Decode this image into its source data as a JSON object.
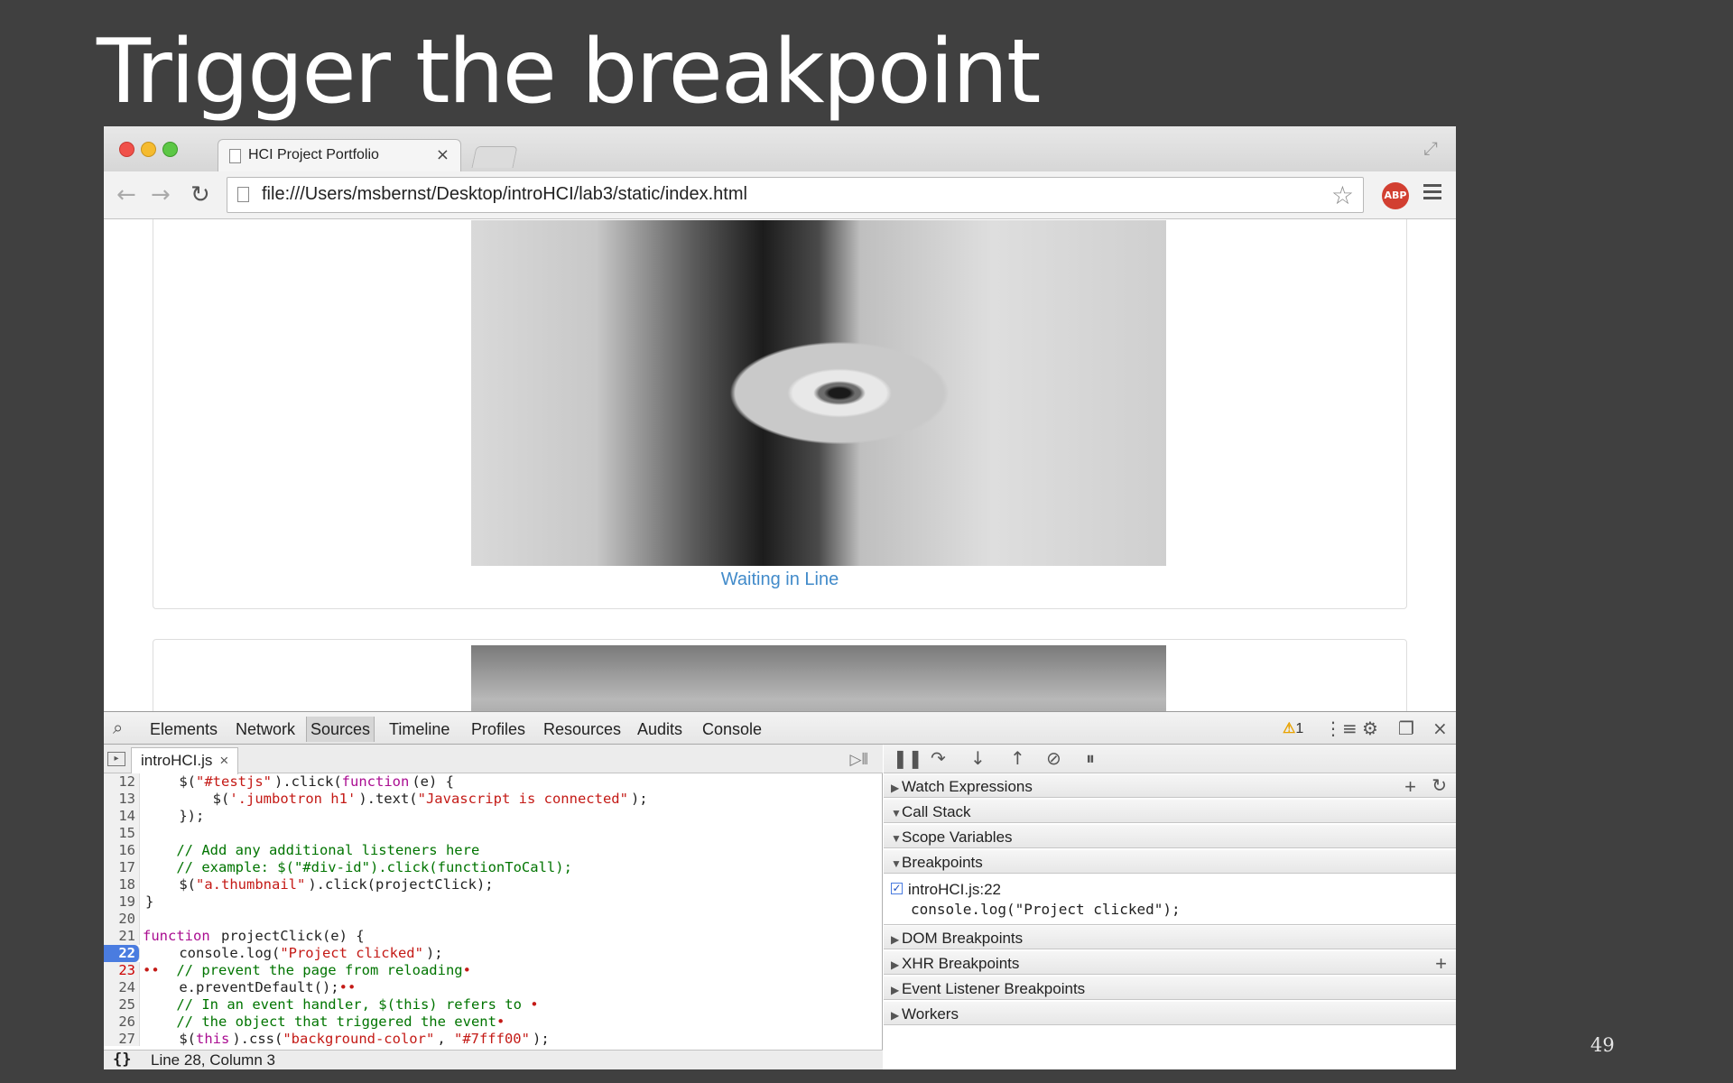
{
  "slide": {
    "title": "Trigger the breakpoint",
    "number": "49"
  },
  "browser": {
    "tab_title": "HCI Project Portfolio",
    "tab_close": "×",
    "url": "file:///Users/msbernst/Desktop/introHCI/lab3/static/index.html",
    "extension_label": "ABP"
  },
  "page": {
    "caption": "Waiting in Line"
  },
  "devtools": {
    "tabs": [
      "Elements",
      "Network",
      "Sources",
      "Timeline",
      "Profiles",
      "Resources",
      "Audits",
      "Console"
    ],
    "selected_tab": "Sources",
    "warning_count": "1",
    "file_tab": "introHCI.js",
    "file_tab_close": "×",
    "status": {
      "pretty_print": "{}",
      "position": "Line 28, Column 3"
    },
    "code": [
      {
        "n": "12",
        "parts": [
          [
            "t",
            "    $("
          ],
          [
            "s",
            "\"#testjs\""
          ],
          [
            "t",
            ").click("
          ],
          [
            "k",
            "function"
          ],
          [
            "t",
            "(e) {"
          ]
        ]
      },
      {
        "n": "13",
        "parts": [
          [
            "t",
            "        $("
          ],
          [
            "s",
            "'.jumbotron h1'"
          ],
          [
            "t",
            ").text("
          ],
          [
            "s",
            "\"Javascript is connected\""
          ],
          [
            "t",
            ");"
          ]
        ]
      },
      {
        "n": "14",
        "parts": [
          [
            "t",
            "    });"
          ]
        ]
      },
      {
        "n": "15",
        "parts": [
          [
            "t",
            ""
          ]
        ]
      },
      {
        "n": "16",
        "parts": [
          [
            "c",
            "    // Add any additional listeners here"
          ]
        ]
      },
      {
        "n": "17",
        "parts": [
          [
            "c",
            "    // example: $(\"#div-id\").click(functionToCall);"
          ]
        ]
      },
      {
        "n": "18",
        "parts": [
          [
            "t",
            "    $("
          ],
          [
            "s",
            "\"a.thumbnail\""
          ],
          [
            "t",
            ").click(projectClick);"
          ]
        ]
      },
      {
        "n": "19",
        "parts": [
          [
            "t",
            "}"
          ]
        ]
      },
      {
        "n": "20",
        "parts": [
          [
            "t",
            ""
          ]
        ]
      },
      {
        "n": "21",
        "parts": [
          [
            "k",
            "function"
          ],
          [
            "t",
            " projectClick(e) {"
          ]
        ]
      },
      {
        "n": "22",
        "bp": true,
        "parts": [
          [
            "t",
            "    console.log("
          ],
          [
            "s",
            "\"Project clicked\""
          ],
          [
            "t",
            ");"
          ]
        ]
      },
      {
        "n": "23",
        "err": true,
        "parts": [
          [
            "s",
            "••  "
          ],
          [
            "c",
            "// prevent the page from reloading"
          ],
          [
            "s",
            "•"
          ]
        ]
      },
      {
        "n": "24",
        "parts": [
          [
            "t",
            "    e.preventDefault();"
          ],
          [
            "s",
            "••"
          ]
        ]
      },
      {
        "n": "25",
        "parts": [
          [
            "c",
            "    // In an event handler, $(this) refers to "
          ],
          [
            "s",
            "•"
          ]
        ]
      },
      {
        "n": "26",
        "parts": [
          [
            "c",
            "    // the object that triggered the event"
          ],
          [
            "s",
            "•"
          ]
        ]
      },
      {
        "n": "27",
        "parts": [
          [
            "t",
            "    $("
          ],
          [
            "k",
            "this"
          ],
          [
            "t",
            ").css("
          ],
          [
            "s",
            "\"background-color\""
          ],
          [
            "t",
            ", "
          ],
          [
            "s",
            "\"#7fff00\""
          ],
          [
            "t",
            ");"
          ]
        ]
      }
    ],
    "sidebar": {
      "watch_expressions": "Watch Expressions",
      "call_stack": "Call Stack",
      "scope_variables": "Scope Variables",
      "breakpoints": "Breakpoints",
      "breakpoint_location": "introHCI.js:22",
      "breakpoint_snippet": "console.log(\"Project clicked\");",
      "dom_breakpoints": "DOM Breakpoints",
      "xhr_breakpoints": "XHR Breakpoints",
      "event_listener_breakpoints": "Event Listener Breakpoints",
      "workers": "Workers"
    }
  }
}
